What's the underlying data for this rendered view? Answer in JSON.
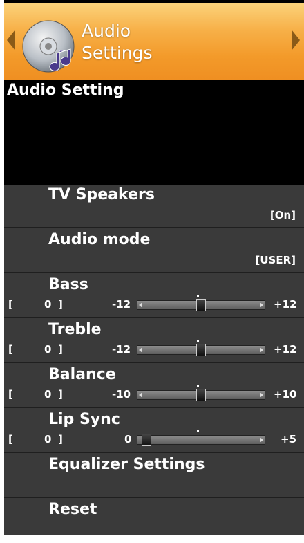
{
  "header": {
    "title": "Audio\nSettings",
    "icon": "disc-music-icon"
  },
  "section_title": "Audio Setting",
  "menu": {
    "tv_speakers": {
      "label": "TV Speakers",
      "value": "[On]"
    },
    "audio_mode": {
      "label": "Audio mode",
      "value": "[USER]"
    },
    "bass": {
      "label": "Bass",
      "open": "[",
      "current": "0",
      "close": "]",
      "min": "-12",
      "max": "+12",
      "level": 0.5
    },
    "treble": {
      "label": "Treble",
      "open": "[",
      "current": "0",
      "close": "]",
      "min": "-12",
      "max": "+12",
      "level": 0.5
    },
    "balance": {
      "label": "Balance",
      "open": "[",
      "current": "0",
      "close": "]",
      "min": "-10",
      "max": "+10",
      "level": 0.5
    },
    "lip_sync": {
      "label": "Lip Sync",
      "open": "[",
      "current": "0",
      "close": "]",
      "min": "0",
      "max": "+5",
      "level": 0.0
    },
    "equalizer": {
      "label": "Equalizer Settings"
    },
    "reset": {
      "label": "Reset"
    }
  },
  "colors": {
    "header_orange": "#f39a2a",
    "menu_gray": "#3a3a3a"
  }
}
